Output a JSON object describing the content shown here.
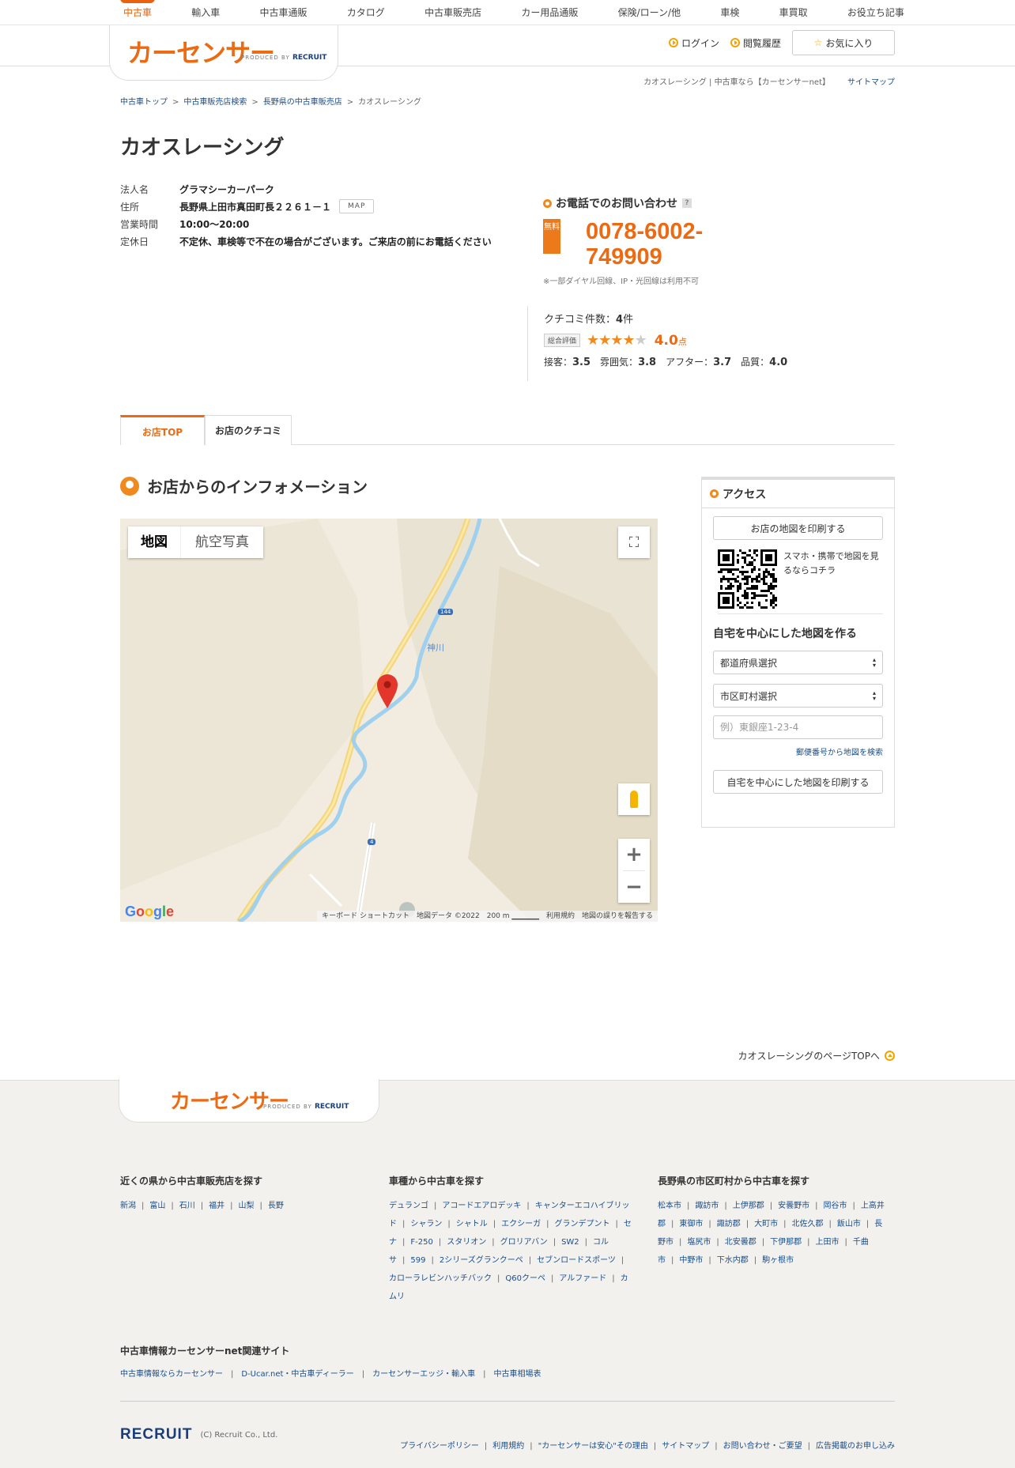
{
  "global_nav": [
    "中古車",
    "輸入車",
    "中古車通販",
    "カタログ",
    "中古車販売店",
    "カー用品通販",
    "保険/ローン/他",
    "車検",
    "車買取",
    "お役立ち記事"
  ],
  "header": {
    "logo": "カーセンサー",
    "produced_by": "PRODUCED BY",
    "recruit": "RECRUIT",
    "login": "ログイン",
    "history": "閲覧履歴",
    "favorites": "お気に入り",
    "meta_text": "カオスレーシング | 中古車なら【カーセンサーnet】",
    "sitemap": "サイトマップ"
  },
  "breadcrumb": [
    "中古車トップ",
    "中古車販売店検索",
    "長野県の中古車販売店",
    "カオスレーシング"
  ],
  "shop": {
    "name": "カオスレーシング",
    "corp_label": "法人名",
    "corp": "グラマシーカーパーク",
    "addr_label": "住所",
    "addr": "長野県上田市真田町長２２６１－１",
    "map_btn": "MAP",
    "hours_label": "営業時間",
    "hours": "10:00～20:00",
    "holiday_label": "定休日",
    "holiday": "不定休、車検等で不在の場合がございます。ご来店の前にお電話ください"
  },
  "tel": {
    "heading": "お電話でのお問い合わせ",
    "help": "?",
    "free": "無料",
    "number_1": "0078-6002-",
    "number_2": "749909",
    "note": "※一部ダイヤル回線、IP・光回線は利用不可"
  },
  "review": {
    "count_label": "クチコミ件数：",
    "count": "4",
    "count_unit": "件",
    "total_badge": "総合評価",
    "rating": 4.0,
    "score": "4.0",
    "score_unit": "点",
    "sub1_label": "接客：",
    "sub1": "3.5",
    "sub2_label": "雰囲気：",
    "sub2": "3.8",
    "sub3_label": "アフター：",
    "sub3": "3.7",
    "sub4_label": "品質：",
    "sub4": "4.0"
  },
  "tabs": [
    "お店TOP",
    "お店のクチコミ"
  ],
  "info_heading": "お店からのインフォメーション",
  "map": {
    "type_map": "地図",
    "type_satellite": "航空写真",
    "river_label": "神川",
    "road1": "144",
    "road2": "4",
    "google": "Google",
    "attribution": "キーボード ショートカット　地図データ ©2022　200 m ▁▁▁▁▁　利用規約　地図の誤りを報告する"
  },
  "access": {
    "heading": "アクセス",
    "print_btn": "お店の地図を印刷する",
    "qr_text": "スマホ・携帯で地図を見るならコチラ",
    "home_heading": "自宅を中心にした地図を作る",
    "pref_select": "都道府県選択",
    "city_select": "市区町村選択",
    "addr_placeholder": "例）東銀座1-23-4",
    "zip_link": "郵便番号から地図を検索",
    "home_print_btn": "自宅を中心にした地図を印刷する"
  },
  "page_top": "カオスレーシングのページTOPへ",
  "footer": {
    "logo": "カーセンサー",
    "produced_by": "PRODUCED BY",
    "recruit": "RECRUIT",
    "col1_title": "近くの県から中古車販売店を探す",
    "col1_links": [
      "新潟",
      "富山",
      "石川",
      "福井",
      "山梨",
      "長野"
    ],
    "col2_title": "車種から中古車を探す",
    "col2_links": [
      "デュランゴ",
      "アコードエアロデッキ",
      "キャンターエコハイブリッド",
      "シャラン",
      "シャトル",
      "エクシーガ",
      "グランデプント",
      "セナ",
      "F-250",
      "スタリオン",
      "グロリアバン",
      "SW2",
      "コルサ",
      "599",
      "2シリーズグランクーペ",
      "セブンロードスポーツ",
      "カローラレビンハッチバック",
      "Q60クーペ",
      "アルファード",
      "カムリ"
    ],
    "col3_title": "長野県の市区町村から中古車を探す",
    "col3_links": [
      "松本市",
      "諏訪市",
      "上伊那郡",
      "安曇野市",
      "岡谷市",
      "上高井郡",
      "東御市",
      "諏訪郡",
      "大町市",
      "北佐久郡",
      "飯山市",
      "長野市",
      "塩尻市",
      "北安曇郡",
      "下伊那郡",
      "上田市",
      "千曲市",
      "中野市",
      "下水内郡",
      "駒ヶ根市"
    ],
    "related_title": "中古車情報カーセンサーnet関連サイト",
    "related_links": [
      "中古車情報ならカーセンサー",
      "D-Ucar.net・中古車ディーラー",
      "カーセンサーエッジ・輸入車",
      "中古車相場表"
    ],
    "recruit_logo": "RECRUIT",
    "copyright": "(C) Recruit Co., Ltd.",
    "bottom_links": [
      "プライバシーポリシー",
      "利用規約",
      "\"カーセンサーは安心\"その理由",
      "サイトマップ",
      "お問い合わせ・ご要望",
      "広告掲載のお申し込み"
    ]
  }
}
